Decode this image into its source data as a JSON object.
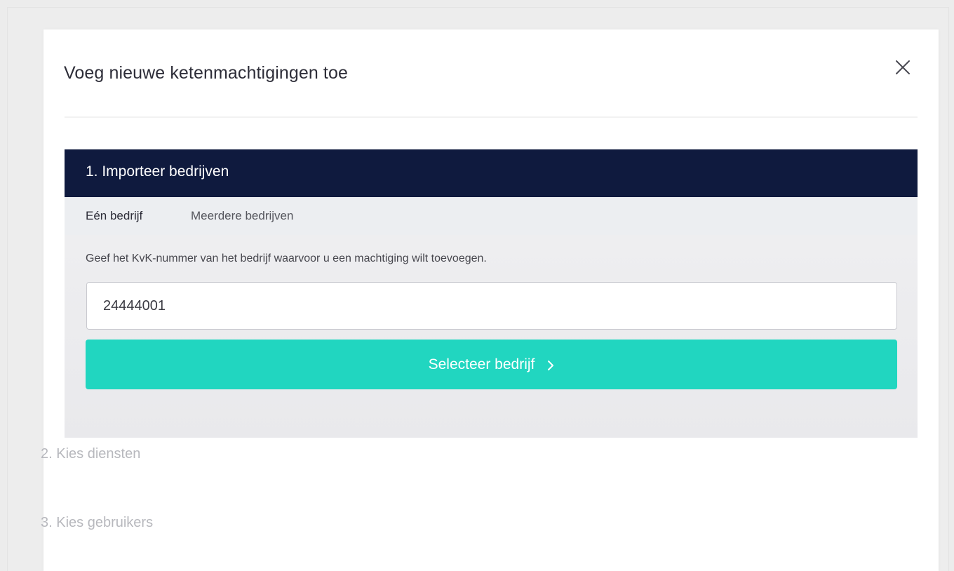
{
  "modal": {
    "title": "Voeg nieuwe ketenmachtigingen toe",
    "close_icon": "close-icon"
  },
  "steps": [
    {
      "label": "1. Importeer bedrijven",
      "active": true,
      "tabs": [
        {
          "label": "Eén bedrijf",
          "selected": true
        },
        {
          "label": "Meerdere bedrijven",
          "selected": false
        }
      ],
      "instructions": "Geef het KvK-nummer van het bedrijf waarvoor u een machtiging wilt toevoegen.",
      "kvk_input": {
        "value": "24444001",
        "placeholder": ""
      },
      "select_button": {
        "label": "Selecteer bedrijf",
        "icon": "chevron-right-icon"
      }
    },
    {
      "label": "2. Kies diensten",
      "active": false
    },
    {
      "label": "3. Kies gebruikers",
      "active": false
    }
  ],
  "colors": {
    "header_bg": "#0f1a3e",
    "accent": "#21d6c0",
    "tab_underline": "#1fcfbd",
    "inactive_text": "#b7b8bd"
  }
}
